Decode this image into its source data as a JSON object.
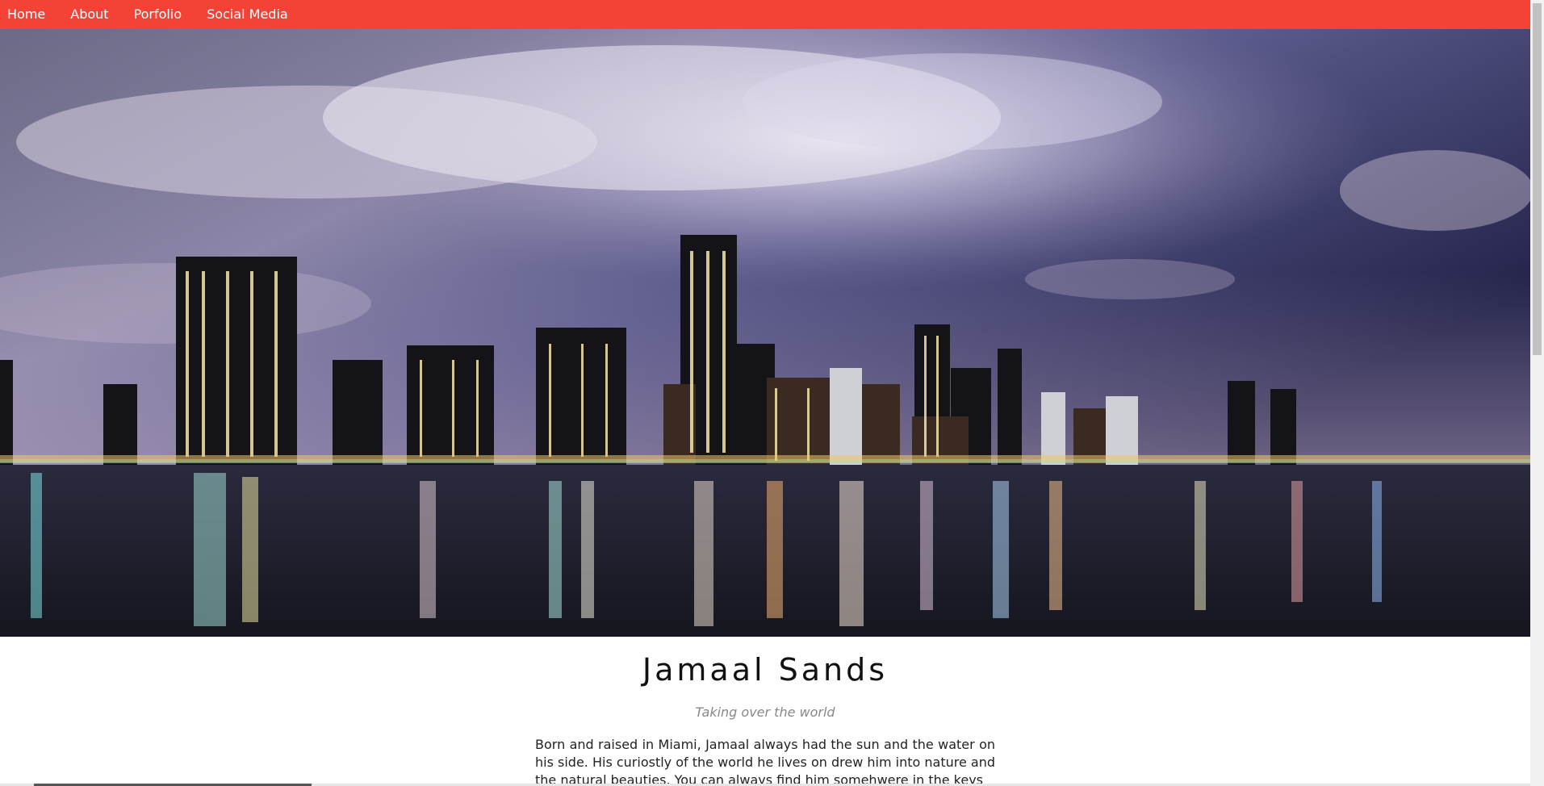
{
  "nav": {
    "items": [
      {
        "label": "Home"
      },
      {
        "label": "About"
      },
      {
        "label": "Porfolio"
      },
      {
        "label": "Social Media"
      }
    ],
    "background_color": "#f44336"
  },
  "hero": {
    "image_description_icon": "city-skyline-night-image"
  },
  "profile": {
    "name": "Jamaal Sands",
    "tagline": "Taking over the world",
    "bio": "Born and raised in Miami, Jamaal always had the sun and the water on his side. His curiostly of the world he lives on drew him into nature and the natural beauties. You can always find him somehwere in the keys"
  }
}
